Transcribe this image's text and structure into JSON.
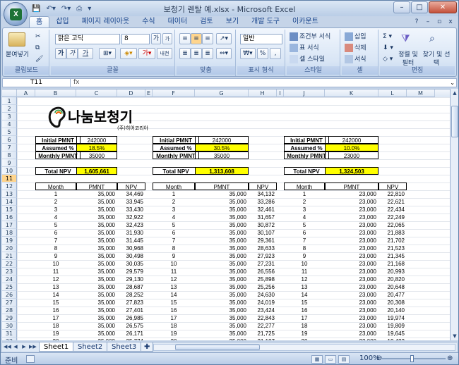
{
  "window": {
    "title": "보청기 렌탈 예.xlsx - Microsoft Excel",
    "app_letter": "X"
  },
  "qat": [
    "save-icon",
    "undo-icon",
    "redo-icon",
    "print-icon"
  ],
  "tabs": [
    "홈",
    "삽입",
    "페이지 레이아웃",
    "수식",
    "데이터",
    "검토",
    "보기",
    "개발 도구",
    "이카운트"
  ],
  "ribbon": {
    "clipboard": {
      "paste": "붙여넣기",
      "label": "클립보드"
    },
    "font": {
      "name": "맑은 고딕",
      "size": "8",
      "bold": "가",
      "italic": "가",
      "underline": "가",
      "grow": "가",
      "shrink": "가",
      "phonetic": "내천",
      "label": "글꼴"
    },
    "align": {
      "label": "맞춤"
    },
    "number": {
      "format": "일반",
      "label": "표시 형식",
      "percent": "%"
    },
    "styles": {
      "cond": "조건부 서식",
      "table": "표 서식",
      "cell": "셀 스타일",
      "label": "스타일"
    },
    "cells": {
      "insert": "삽입",
      "delete": "삭제",
      "format": "서식",
      "label": "셀"
    },
    "edit": {
      "sort": "정렬 및 필터",
      "find": "찾기 및 선택",
      "label": "편집"
    }
  },
  "formula_bar": {
    "name_box": "T11",
    "fx": "fx",
    "value": ""
  },
  "columns": [
    "A",
    "B",
    "C",
    "D",
    "E",
    "F",
    "G",
    "H",
    "I",
    "J",
    "K",
    "L",
    "M"
  ],
  "rows": [
    "1",
    "2",
    "3",
    "4",
    "5",
    "6",
    "7",
    "8",
    "9",
    "10",
    "11",
    "12",
    "13",
    "14",
    "15",
    "16",
    "17",
    "18",
    "19",
    "20",
    "21",
    "22",
    "23",
    "24",
    "25",
    "26",
    "27",
    "28",
    "29",
    "30",
    "31",
    "32"
  ],
  "selected_row": "11",
  "logo": {
    "name": "나눔보청기",
    "sub": "(주)히어코리아"
  },
  "blocks": [
    {
      "inputs": [
        [
          "Initial PMNT",
          "242000"
        ],
        [
          "Assumed %",
          "18.5%"
        ],
        [
          "Monthly PMNT",
          "35000"
        ]
      ],
      "total_label": "Total NPV",
      "total": "1,605,661",
      "headers": [
        "Month",
        "PMNT",
        "NPV"
      ],
      "rows": [
        [
          "1",
          "35,000",
          "34,469"
        ],
        [
          "2",
          "35,000",
          "33,945"
        ],
        [
          "3",
          "35,000",
          "33,430"
        ],
        [
          "4",
          "35,000",
          "32,922"
        ],
        [
          "5",
          "35,000",
          "32,423"
        ],
        [
          "6",
          "35,000",
          "31,930"
        ],
        [
          "7",
          "35,000",
          "31,445"
        ],
        [
          "8",
          "35,000",
          "30,968"
        ],
        [
          "9",
          "35,000",
          "30,498"
        ],
        [
          "10",
          "35,000",
          "30,035"
        ],
        [
          "11",
          "35,000",
          "29,579"
        ],
        [
          "12",
          "35,000",
          "29,130"
        ],
        [
          "13",
          "35,000",
          "28,687"
        ],
        [
          "14",
          "35,000",
          "28,252"
        ],
        [
          "15",
          "35,000",
          "27,823"
        ],
        [
          "16",
          "35,000",
          "27,401"
        ],
        [
          "17",
          "35,000",
          "26,985"
        ],
        [
          "18",
          "35,000",
          "26,575"
        ],
        [
          "19",
          "35,000",
          "26,171"
        ],
        [
          "20",
          "35,000",
          "25,774"
        ]
      ]
    },
    {
      "inputs": [
        [
          "Initial PMNT",
          "242000"
        ],
        [
          "Assumed %",
          "30.5%"
        ],
        [
          "Monthly PMNT",
          "35000"
        ]
      ],
      "total_label": "Total NPV",
      "total": "1,313,608",
      "headers": [
        "Month",
        "PMNT",
        "NPV"
      ],
      "rows": [
        [
          "1",
          "35,000",
          "34,132"
        ],
        [
          "2",
          "35,000",
          "33,286"
        ],
        [
          "3",
          "35,000",
          "32,461"
        ],
        [
          "4",
          "35,000",
          "31,657"
        ],
        [
          "5",
          "35,000",
          "30,872"
        ],
        [
          "6",
          "35,000",
          "30,107"
        ],
        [
          "7",
          "35,000",
          "29,361"
        ],
        [
          "8",
          "35,000",
          "28,633"
        ],
        [
          "9",
          "35,000",
          "27,923"
        ],
        [
          "10",
          "35,000",
          "27,231"
        ],
        [
          "11",
          "35,000",
          "26,556"
        ],
        [
          "12",
          "35,000",
          "25,898"
        ],
        [
          "13",
          "35,000",
          "25,256"
        ],
        [
          "14",
          "35,000",
          "24,630"
        ],
        [
          "15",
          "35,000",
          "24,019"
        ],
        [
          "16",
          "35,000",
          "23,424"
        ],
        [
          "17",
          "35,000",
          "22,843"
        ],
        [
          "18",
          "35,000",
          "22,277"
        ],
        [
          "19",
          "35,000",
          "21,725"
        ],
        [
          "20",
          "35,000",
          "21,187"
        ]
      ]
    },
    {
      "inputs": [
        [
          "Initial PMNT",
          "242000"
        ],
        [
          "Assumed %",
          "10.0%"
        ],
        [
          "Monthly PMNT",
          "23000"
        ]
      ],
      "total_label": "Total NPV",
      "total": "1,324,503",
      "headers": [
        "Month",
        "PMNT",
        "NPV"
      ],
      "rows": [
        [
          "1",
          "23,000",
          "22,810"
        ],
        [
          "2",
          "23,000",
          "22,621"
        ],
        [
          "3",
          "23,000",
          "22,434"
        ],
        [
          "4",
          "23,000",
          "22,249"
        ],
        [
          "5",
          "23,000",
          "22,065"
        ],
        [
          "6",
          "23,000",
          "21,883"
        ],
        [
          "7",
          "23,000",
          "21,702"
        ],
        [
          "8",
          "23,000",
          "21,523"
        ],
        [
          "9",
          "23,000",
          "21,345"
        ],
        [
          "10",
          "23,000",
          "21,168"
        ],
        [
          "11",
          "23,000",
          "20,993"
        ],
        [
          "12",
          "23,000",
          "20,820"
        ],
        [
          "13",
          "23,000",
          "20,648"
        ],
        [
          "14",
          "23,000",
          "20,477"
        ],
        [
          "15",
          "23,000",
          "20,308"
        ],
        [
          "16",
          "23,000",
          "20,140"
        ],
        [
          "17",
          "23,000",
          "19,974"
        ],
        [
          "18",
          "23,000",
          "19,809"
        ],
        [
          "19",
          "23,000",
          "19,645"
        ],
        [
          "20",
          "23,000",
          "19,483"
        ]
      ]
    }
  ],
  "sheets": [
    "Sheet1",
    "Sheet2",
    "Sheet3"
  ],
  "active_sheet": "Sheet1",
  "status": {
    "ready": "준비",
    "zoom": "100%"
  }
}
